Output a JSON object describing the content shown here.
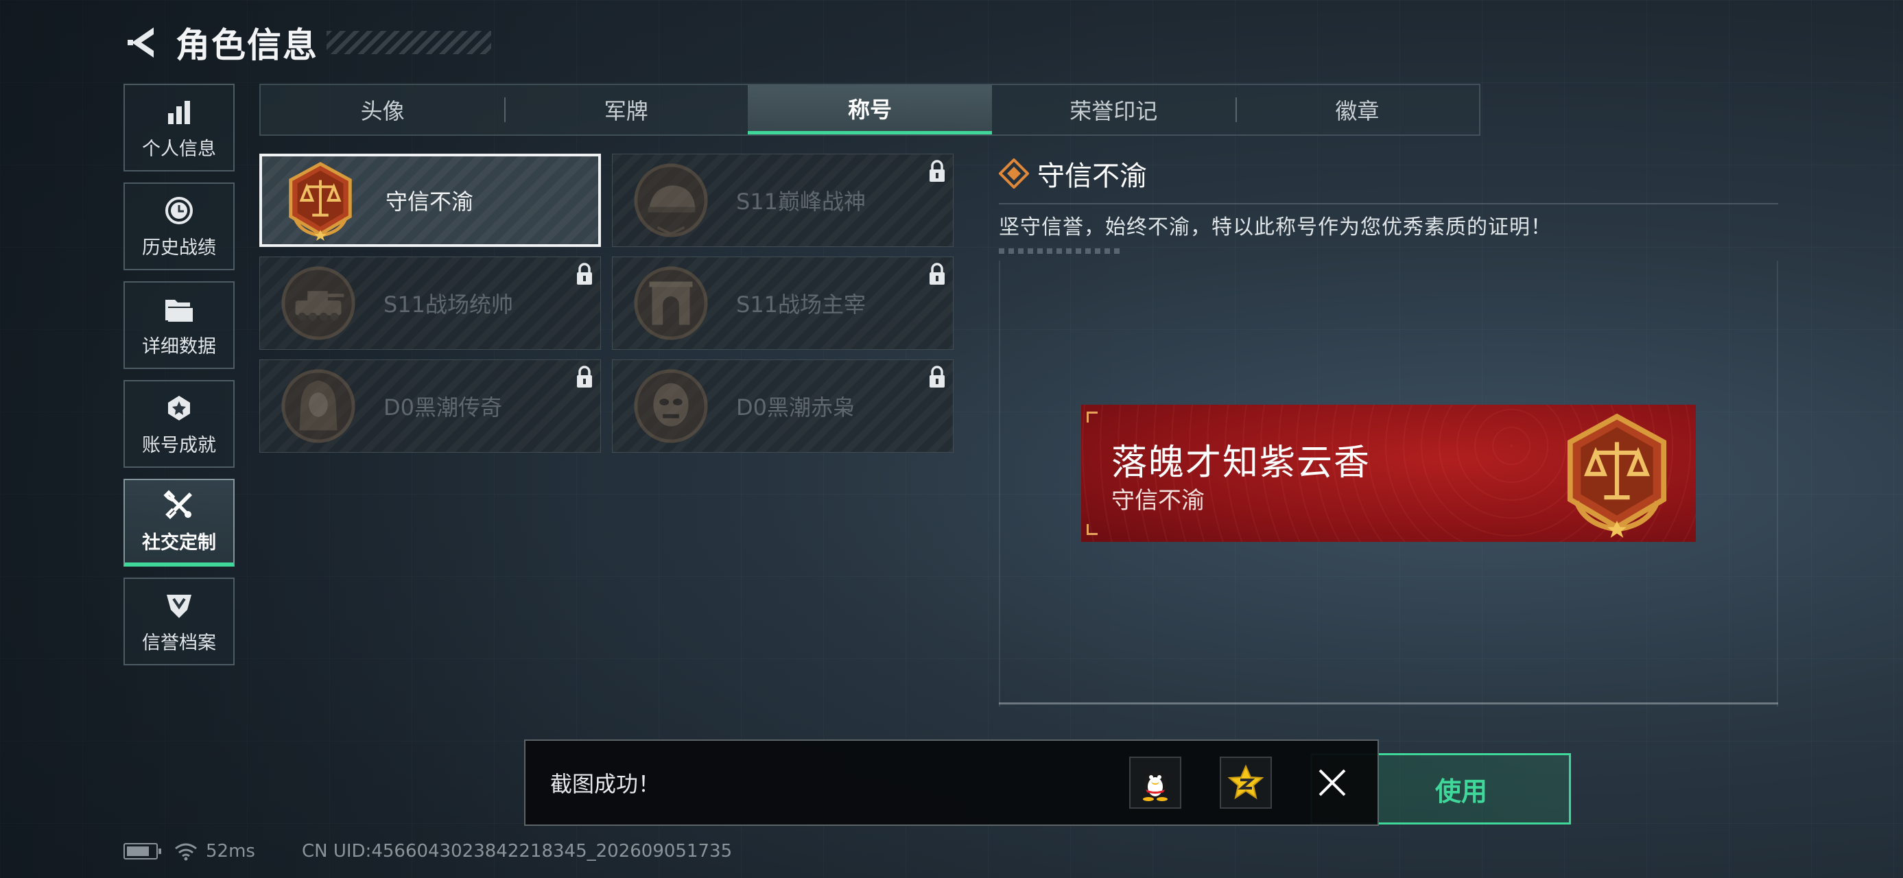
{
  "header": {
    "title": "角色信息"
  },
  "sidenav": {
    "items": [
      {
        "label": "个人信息",
        "icon": "bar-chart-icon"
      },
      {
        "label": "历史战绩",
        "icon": "clock-icon"
      },
      {
        "label": "详细数据",
        "icon": "folder-icon"
      },
      {
        "label": "账号成就",
        "icon": "achievement-icon"
      },
      {
        "label": "社交定制",
        "icon": "tools-icon",
        "active": true
      },
      {
        "label": "信誉档案",
        "icon": "shield-badge-icon"
      }
    ]
  },
  "tabs": [
    {
      "label": "头像"
    },
    {
      "label": "军牌"
    },
    {
      "label": "称号",
      "active": true
    },
    {
      "label": "荣誉印记"
    },
    {
      "label": "徽章"
    }
  ],
  "titles": [
    {
      "name": "守信不渝",
      "medal": "scales-medal-icon",
      "locked": false,
      "selected": true
    },
    {
      "name": "S11巅峰战神",
      "medal": "helmet-medal-icon",
      "locked": true
    },
    {
      "name": "S11战场统帅",
      "medal": "tank-medal-icon",
      "locked": true
    },
    {
      "name": "S11战场主宰",
      "medal": "arch-medal-icon",
      "locked": true
    },
    {
      "name": "D0黑潮传奇",
      "medal": "hooded-figure-medal-icon",
      "locked": true
    },
    {
      "name": "D0黑潮赤枭",
      "medal": "masked-face-medal-icon",
      "locked": true
    }
  ],
  "detail": {
    "name": "守信不渝",
    "description": "坚守信誉，始终不渝，特以此称号作为您优秀素质的证明！"
  },
  "banner": {
    "player_name": "落魄才知紫云香",
    "title": "守信不渝"
  },
  "use_button": {
    "label": "使用"
  },
  "toast": {
    "message": "截图成功！",
    "share_qq_icon": "qq-penguin-icon",
    "share_qzone_icon": "qzone-star-icon",
    "close_icon": "close-icon"
  },
  "status": {
    "ping": "52ms",
    "uid": "CN UID:4566043023842218345_202609051735"
  },
  "colors": {
    "accent": "#3fd79a",
    "banner_red": "#8e1417",
    "medal_gold": "#d89a3b"
  }
}
